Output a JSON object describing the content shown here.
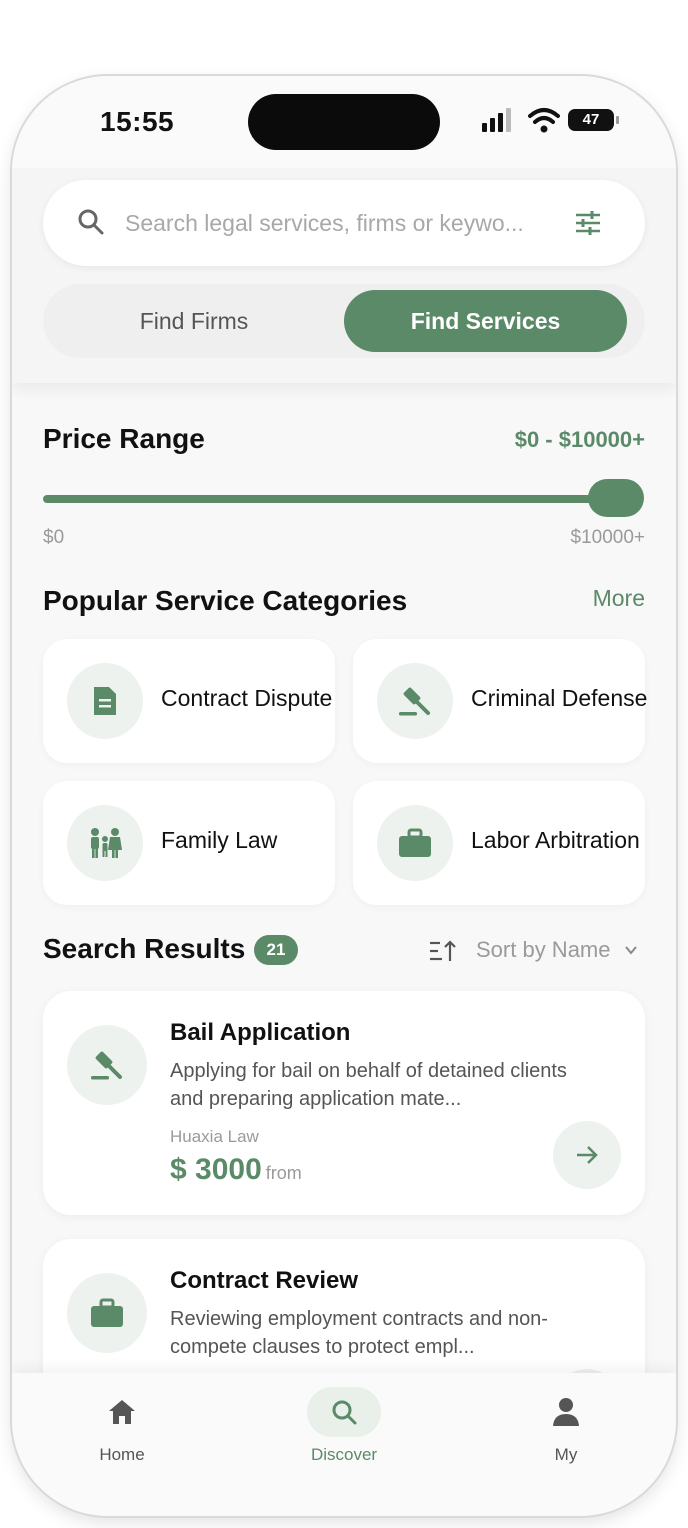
{
  "status": {
    "time": "15:55",
    "battery": "47"
  },
  "search": {
    "placeholder": "Search legal services, firms or keywo..."
  },
  "segments": {
    "firms": "Find Firms",
    "services": "Find Services"
  },
  "price": {
    "title": "Price Range",
    "value": "$0 - $10000+",
    "min": "$0",
    "max": "$10000+",
    "level_percent": 100
  },
  "categories": {
    "title": "Popular Service Categories",
    "more": "More",
    "items": [
      {
        "label": "Contract Dispute",
        "icon": "document-icon"
      },
      {
        "label": "Criminal Defense",
        "icon": "gavel-icon"
      },
      {
        "label": "Family Law",
        "icon": "family-icon"
      },
      {
        "label": "Labor Arbitration",
        "icon": "briefcase-icon"
      }
    ]
  },
  "results": {
    "title": "Search Results",
    "count": "21",
    "sort_label": "Sort by Name",
    "items": [
      {
        "title": "Bail Application",
        "desc": "Applying for bail on behalf of detained clients and preparing application mate...",
        "firm": "Huaxia Law",
        "price": "$ 3000",
        "from": "from",
        "icon": "gavel-icon"
      },
      {
        "title": "Contract Review",
        "desc": "Reviewing employment contracts and non-compete clauses to protect empl...",
        "firm": "",
        "price": "",
        "from": "",
        "icon": "briefcase-icon"
      }
    ]
  },
  "tabs": [
    {
      "label": "Home",
      "icon": "home-icon"
    },
    {
      "label": "Discover",
      "icon": "search-icon",
      "active": true
    },
    {
      "label": "My",
      "icon": "person-icon"
    }
  ],
  "colors": {
    "accent": "#5b8a68",
    "accent_light": "#edf2ee"
  }
}
